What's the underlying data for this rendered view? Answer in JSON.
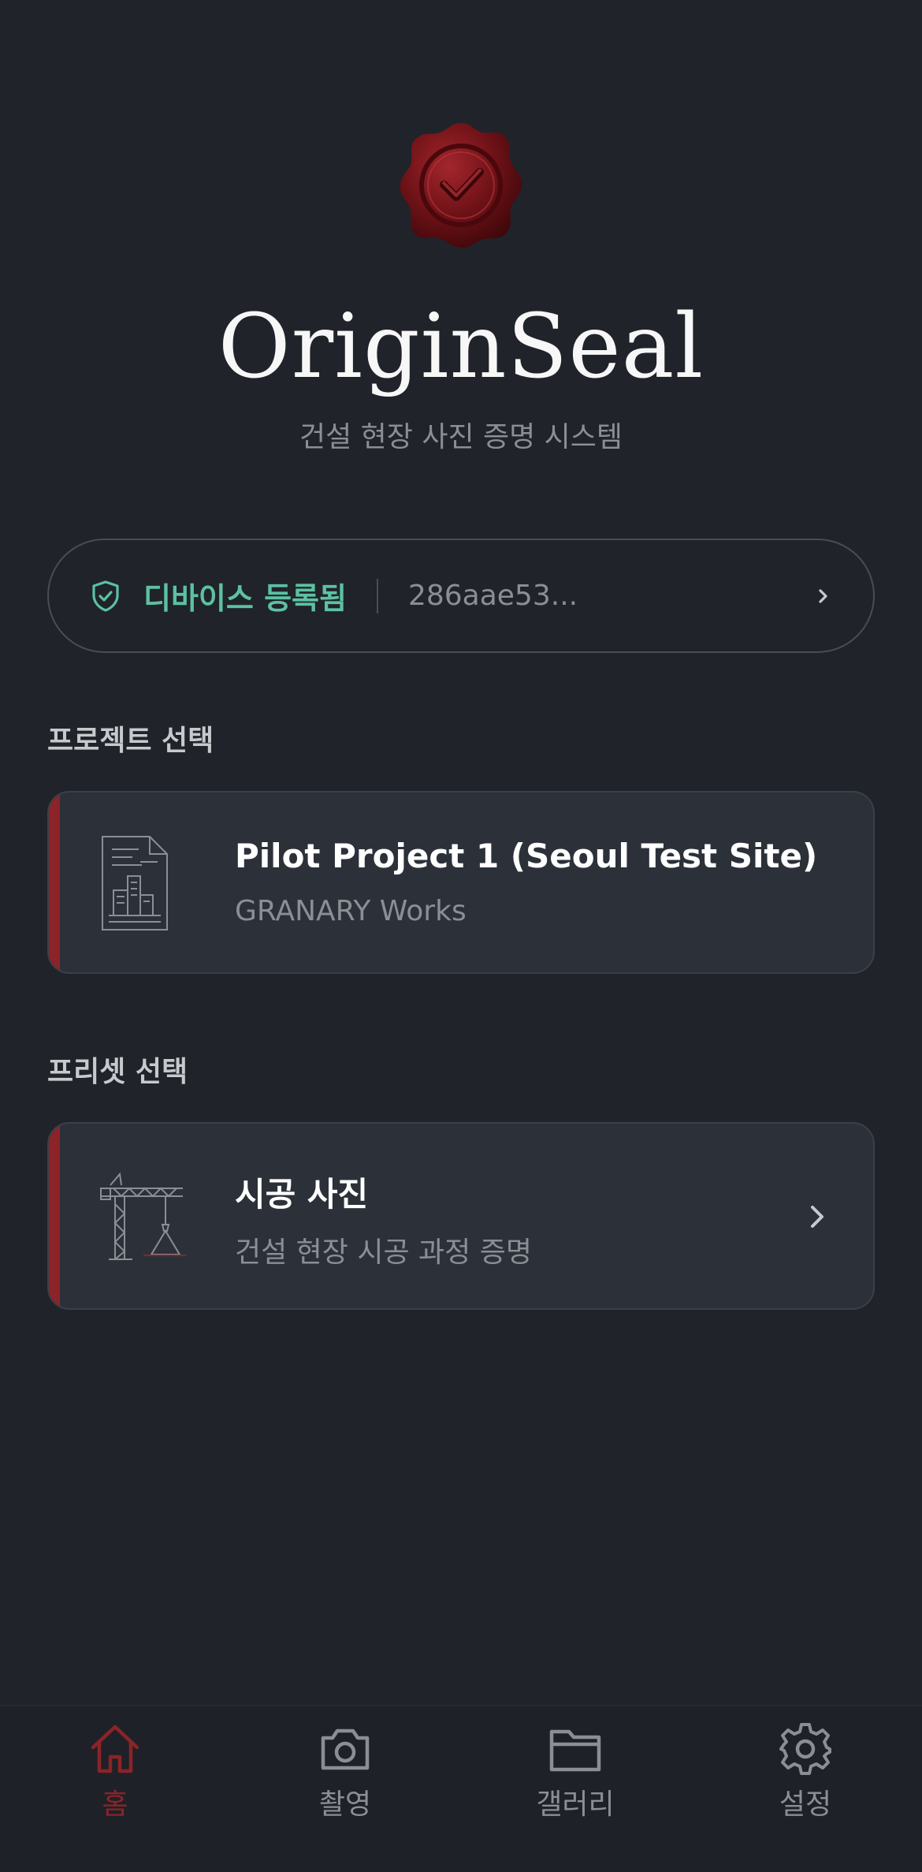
{
  "header": {
    "app_name": "OriginSeal",
    "subtitle": "건설 현장 사진 증명 시스템",
    "logo_icon": "wax-seal-check-icon"
  },
  "device": {
    "status_label": "디바이스 등록됨",
    "device_id": "286aae53...",
    "status_color": "#5cc1a2",
    "icon": "shield-check-icon"
  },
  "project_section": {
    "label": "프로젝트 선택",
    "project": {
      "name": "Pilot Project 1 (Seoul Test Site)",
      "organization": "GRANARY Works",
      "icon": "building-document-icon"
    }
  },
  "preset_section": {
    "label": "프리셋 선택",
    "preset": {
      "name": "시공 사진",
      "description": "건설 현장 시공 과정 증명",
      "icon": "crane-icon"
    }
  },
  "nav": {
    "items": [
      {
        "label": "홈",
        "icon": "home-icon",
        "active": true
      },
      {
        "label": "촬영",
        "icon": "camera-icon",
        "active": false
      },
      {
        "label": "갤러리",
        "icon": "folder-icon",
        "active": false
      },
      {
        "label": "설정",
        "icon": "gear-icon",
        "active": false
      }
    ]
  },
  "colors": {
    "background": "#20232a",
    "card": "#2c3139",
    "accent": "#8c2328",
    "muted_text": "#8b8e94"
  }
}
